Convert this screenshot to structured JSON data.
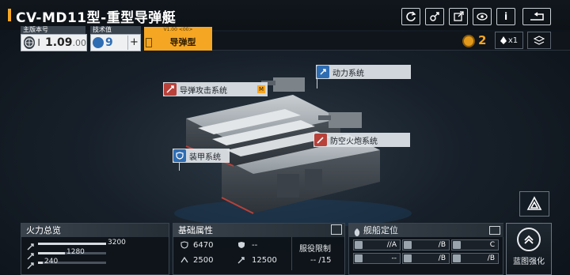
{
  "header": {
    "title": "CV-MD11型-重型导弹艇",
    "buttons": [
      "refresh-icon",
      "link-icon",
      "share-icon",
      "view-icon",
      "info-icon",
      "back-icon"
    ],
    "info_label": "i"
  },
  "version": {
    "main_label": "主版本号",
    "main_index": "I",
    "main_value": "1.09",
    "main_suffix": ".00",
    "tech_label": "技术值",
    "tech_value": "9",
    "tech_button": "+",
    "ver_tag": "V1.00 <00>",
    "type_label": "导弹型"
  },
  "resources": {
    "medal_count": "2",
    "chip_count": "x1"
  },
  "callouts": {
    "missile": "导弹攻击系统",
    "missile_tag": "M",
    "power": "动力系统",
    "aa": "防空火炮系统",
    "armor": "装甲系统"
  },
  "firepower": {
    "title": "火力总览",
    "rows": [
      {
        "value": "3200",
        "ratio": 1.0
      },
      {
        "value": "1280",
        "ratio": 0.4
      },
      {
        "value": "240",
        "ratio": 0.075
      }
    ]
  },
  "attributes": {
    "title": "基础属性",
    "hp": "6470",
    "defense": "--",
    "speed": "2500",
    "range": "12500",
    "service_label": "服役限制",
    "service_value": "-- /15"
  },
  "positioning": {
    "title": "舰船定位",
    "slots": [
      {
        "value": "//A"
      },
      {
        "value": "/B"
      },
      {
        "value": "C"
      },
      {
        "value": "--"
      },
      {
        "value": "/B"
      },
      {
        "value": "/B"
      }
    ]
  },
  "blueprint": {
    "label": "蓝图强化"
  },
  "colors": {
    "accent": "#f5a623",
    "callout_red": "#b8413a",
    "callout_blue": "#2f6db3"
  }
}
